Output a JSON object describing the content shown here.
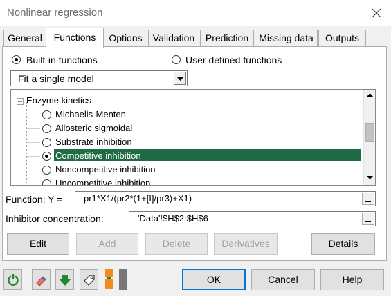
{
  "window": {
    "title": "Nonlinear regression",
    "close_icon": "close-icon"
  },
  "tabs": [
    {
      "label": "General",
      "active": false
    },
    {
      "label": "Functions",
      "active": true
    },
    {
      "label": "Options",
      "active": false
    },
    {
      "label": "Validation",
      "active": false
    },
    {
      "label": "Prediction",
      "active": false
    },
    {
      "label": "Missing data",
      "active": false
    },
    {
      "label": "Outputs",
      "active": false
    }
  ],
  "function_source": {
    "builtin_label": "Built-in functions",
    "builtin_selected": true,
    "user_label": "User defined functions",
    "user_selected": false
  },
  "model_select": {
    "value": "Fit a single model"
  },
  "tree": {
    "group_label": "Enzyme kinetics",
    "items": [
      {
        "label": "Michaelis-Menten",
        "selected": false
      },
      {
        "label": "Allosteric sigmoidal",
        "selected": false
      },
      {
        "label": "Substrate inhibition",
        "selected": false
      },
      {
        "label": "Competitive inhibition",
        "selected": true
      },
      {
        "label": "Noncompetitive inhibition",
        "selected": false
      },
      {
        "label": "Uncompetitive inhibition",
        "selected": false
      }
    ],
    "selection_color": "#1e6b44"
  },
  "function_field": {
    "label": "Function: Y =",
    "value": "pr1*X1/(pr2*(1+[I]/pr3)+X1)"
  },
  "inhibitor_field": {
    "label": "Inhibitor concentration:",
    "value": "'Data'!$H$2:$H$6"
  },
  "action_buttons": {
    "edit": "Edit",
    "add": "Add",
    "delete": "Delete",
    "derivatives": "Derivatives",
    "details": "Details"
  },
  "footer": {
    "tool_icons": [
      "refresh-icon",
      "eraser-icon",
      "download-arrow-icon",
      "tag-icon",
      "layout-toggle-icon"
    ],
    "ok": "OK",
    "cancel": "Cancel",
    "help": "Help"
  }
}
